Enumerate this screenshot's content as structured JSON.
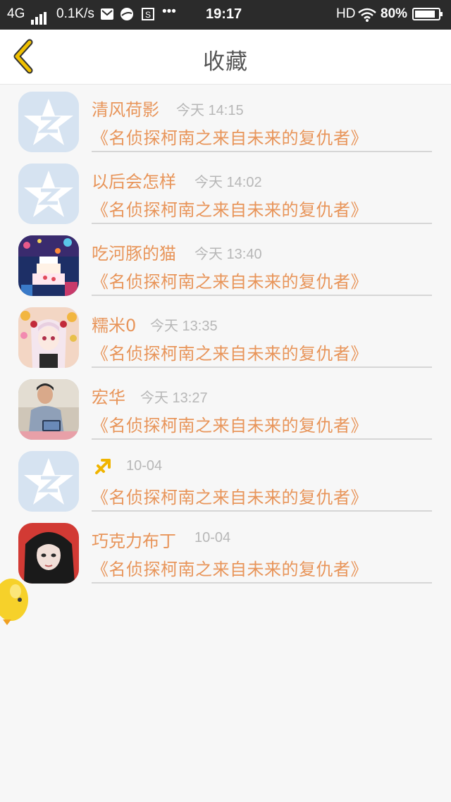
{
  "status_bar": {
    "network": "4G",
    "speed": "0.1K/s",
    "time": "19:17",
    "hd": "HD",
    "battery": "80%"
  },
  "header": {
    "title": "收藏"
  },
  "favorites": [
    {
      "name": "清风荷影",
      "time": "今天 14:15",
      "title": "《名侦探柯南之来自未来的复仇者》",
      "avatar": "default-qzone-avatar"
    },
    {
      "name": "以后会怎样",
      "time": "今天 14:02",
      "title": "《名侦探柯南之来自未来的复仇者》",
      "avatar": "default-qzone-avatar"
    },
    {
      "name": "吃河豚的猫",
      "time": "今天 13:40",
      "title": "《名侦探柯南之来自未来的复仇者》",
      "avatar": "cake-avatar"
    },
    {
      "name": "糯米0",
      "time": "今天 13:35",
      "title": "《名侦探柯南之来自未来的复仇者》",
      "avatar": "anime-girl-avatar"
    },
    {
      "name": "宏华",
      "time": "今天 13:27",
      "title": "《名侦探柯南之来自未来的复仇者》",
      "avatar": "person-tablet-avatar"
    },
    {
      "name": "",
      "time": "10-04",
      "title": "《名侦探柯南之来自未来的复仇者》",
      "avatar": "default-qzone-avatar",
      "name_icon": "sagittarius-icon"
    },
    {
      "name": "巧克力布丁",
      "time": "10-04",
      "title": "《名侦探柯南之来自未来的复仇者》",
      "avatar": "girl-portrait-avatar"
    }
  ],
  "colors": {
    "accent": "#e8955a",
    "muted": "#b7b7b7",
    "back_chevron": "#f0c000"
  }
}
